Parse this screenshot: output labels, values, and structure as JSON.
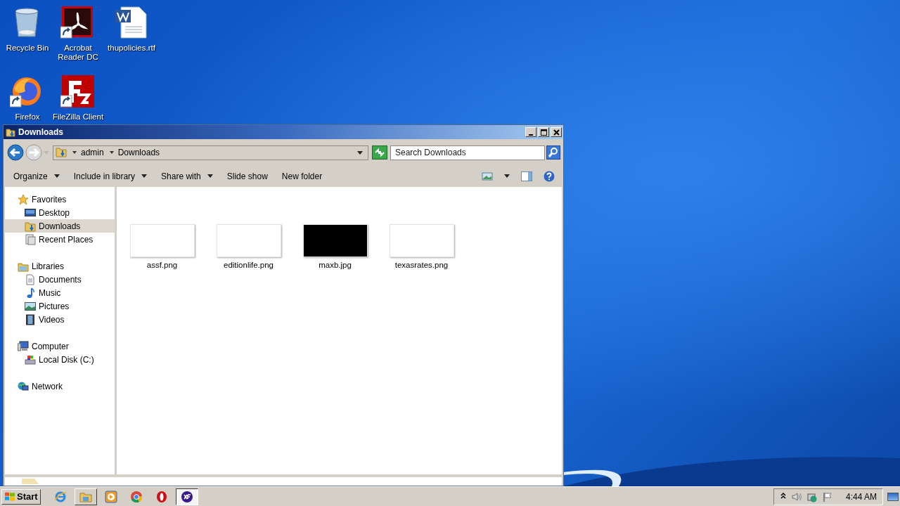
{
  "desktop_icons": [
    {
      "label": "Recycle Bin",
      "kind": "bin",
      "shortcut": false
    },
    {
      "label": "Acrobat Reader DC",
      "kind": "acrobat",
      "shortcut": true
    },
    {
      "label": "thupolicies.rtf",
      "kind": "document",
      "shortcut": false
    },
    {
      "label": "Firefox",
      "kind": "firefox",
      "shortcut": true
    },
    {
      "label": "FileZilla Client",
      "kind": "filezilla",
      "shortcut": true
    }
  ],
  "window": {
    "title": "Downloads",
    "breadcrumb": [
      "admin",
      "Downloads"
    ],
    "search": {
      "placeholder": "Search Downloads"
    },
    "toolbar": [
      {
        "label": "Organize",
        "dropdown": true
      },
      {
        "label": "Include in library",
        "dropdown": true
      },
      {
        "label": "Share with",
        "dropdown": true
      },
      {
        "label": "Slide show",
        "dropdown": false
      },
      {
        "label": "New folder",
        "dropdown": false
      }
    ],
    "nav": [
      {
        "label": "Favorites",
        "kind": "star",
        "selected": false,
        "children": [
          {
            "label": "Desktop",
            "kind": "desktop",
            "selected": false
          },
          {
            "label": "Downloads",
            "kind": "downloads",
            "selected": true
          },
          {
            "label": "Recent Places",
            "kind": "recent",
            "selected": false
          }
        ]
      },
      {
        "label": "Libraries",
        "kind": "library",
        "selected": false,
        "children": [
          {
            "label": "Documents",
            "kind": "documents",
            "selected": false
          },
          {
            "label": "Music",
            "kind": "music",
            "selected": false
          },
          {
            "label": "Pictures",
            "kind": "pictures",
            "selected": false
          },
          {
            "label": "Videos",
            "kind": "videos",
            "selected": false
          }
        ]
      },
      {
        "label": "Computer",
        "kind": "computer",
        "selected": false,
        "children": [
          {
            "label": "Local Disk (C:)",
            "kind": "disk",
            "selected": false
          }
        ]
      },
      {
        "label": "Network",
        "kind": "network",
        "selected": false
      }
    ],
    "files": [
      {
        "name": "assf.png",
        "kind": "light"
      },
      {
        "name": "editionlife.png",
        "kind": "light"
      },
      {
        "name": "maxb.jpg",
        "kind": "dark"
      },
      {
        "name": "texasrates.png",
        "kind": "light"
      }
    ]
  },
  "taskbar": {
    "start": "Start",
    "apps": [
      {
        "kind": "ie",
        "open": false,
        "selected": false
      },
      {
        "kind": "explorer",
        "open": true,
        "selected": false
      },
      {
        "kind": "player",
        "open": false,
        "selected": false
      },
      {
        "kind": "chrome",
        "open": false,
        "selected": false
      },
      {
        "kind": "opera",
        "open": false,
        "selected": false
      },
      {
        "kind": "xf",
        "open": true,
        "selected": true
      }
    ],
    "clock": "4:44 AM"
  }
}
